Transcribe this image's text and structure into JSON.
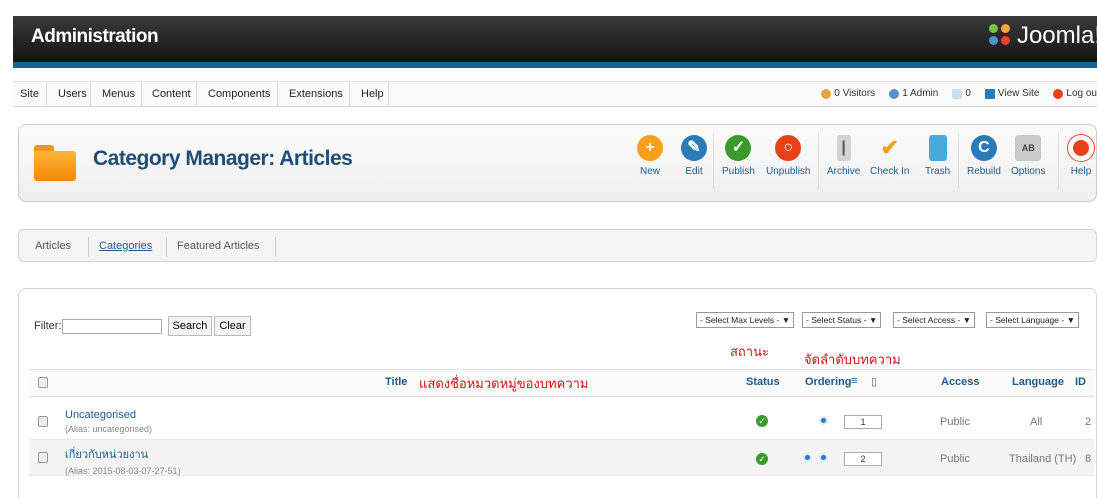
{
  "header": {
    "title": "Administration",
    "logo_text": "Joomla!"
  },
  "menu": {
    "items": [
      "Site",
      "Users",
      "Menus",
      "Content",
      "Components",
      "Extensions",
      "Help"
    ]
  },
  "status": {
    "visitors": "0 Visitors",
    "admins": "1 Admin",
    "messages": "0",
    "view_site": "View Site",
    "logout": "Log ou"
  },
  "page": {
    "title": "Category Manager: Articles"
  },
  "toolbar": {
    "buttons": [
      {
        "label": "New",
        "icon": "plus-icon",
        "color": "#f7a11a"
      },
      {
        "label": "Edit",
        "icon": "pencil-icon",
        "color": "#2b7bb9"
      },
      {
        "label": "Publish",
        "icon": "check-icon",
        "color": "#3a9a2a"
      },
      {
        "label": "Unpublish",
        "icon": "stop-icon",
        "color": "#e8411a"
      },
      {
        "label": "Archive",
        "icon": "archive-icon",
        "color": "#cfcfcf"
      },
      {
        "label": "Check In",
        "icon": "checkin-icon",
        "color": "#f0a01a"
      },
      {
        "label": "Trash",
        "icon": "trash-icon",
        "color": "#4aa9d8"
      },
      {
        "label": "Rebuild",
        "icon": "rebuild-icon",
        "color": "#2b7bb9"
      },
      {
        "label": "Options",
        "icon": "options-icon",
        "color": "#c9c9c9"
      },
      {
        "label": "Help",
        "icon": "help-icon",
        "color": "#e8411a"
      }
    ]
  },
  "tabs": [
    "Articles",
    "Categories",
    "Featured Articles"
  ],
  "filter": {
    "label": "Filter:",
    "value": "",
    "search_label": "Search",
    "clear_label": "Clear",
    "selects": [
      "- Select Max Levels -",
      "- Select Status -",
      "- Select Access -",
      "- Select Language -"
    ]
  },
  "table": {
    "headers": {
      "title": "Title",
      "status": "Status",
      "ordering": "Ordering",
      "access": "Access",
      "language": "Language",
      "id": "ID"
    },
    "rows": [
      {
        "title": "Uncategorised",
        "alias": "(Alias: uncategorised)",
        "order": "1",
        "access": "Public",
        "language": "All",
        "id": "2"
      },
      {
        "title": "เกี่ยวกับหน่วยงาน",
        "alias": "(Alias: 2015-08-03-07-27-51)",
        "order": "2",
        "access": "Public",
        "language": "Thailand (TH)",
        "id": "8"
      }
    ]
  },
  "annotations": {
    "title_note": "แสดงชื่อหมวดหมู่ของบทความ",
    "status_note": "สถานะ",
    "ordering_note": "จัดลำดับบทความ"
  }
}
